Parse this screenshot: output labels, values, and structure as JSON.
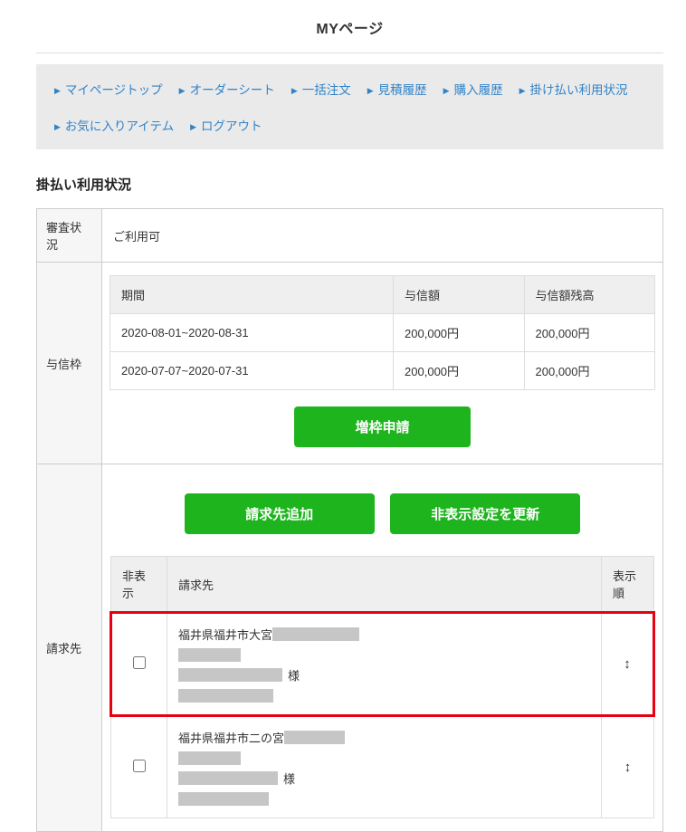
{
  "page": {
    "title": "MYページ"
  },
  "nav": {
    "arrow": "▶",
    "items": [
      {
        "label": "マイページトップ"
      },
      {
        "label": "オーダーシート"
      },
      {
        "label": "一括注文"
      },
      {
        "label": "見積履歴"
      },
      {
        "label": "購入履歴"
      },
      {
        "label": "掛け払い利用状況"
      },
      {
        "label": "お気に入りアイテム"
      },
      {
        "label": "ログアウト"
      }
    ]
  },
  "section": {
    "heading": "掛払い利用状況"
  },
  "status": {
    "label": "審査状況",
    "value": "ご利用可"
  },
  "credit": {
    "label": "与信枠",
    "columns": {
      "period": "期間",
      "amount": "与信額",
      "balance": "与信額残高"
    },
    "rows": [
      {
        "period": "2020-08-01~2020-08-31",
        "amount": "200,000円",
        "balance": "200,000円"
      },
      {
        "period": "2020-07-07~2020-07-31",
        "amount": "200,000円",
        "balance": "200,000円"
      }
    ],
    "increase_button": "増枠申請"
  },
  "billing": {
    "label": "請求先",
    "add_button": "請求先追加",
    "update_button": "非表示設定を更新",
    "columns": {
      "hide": "非表示",
      "address": "請求先",
      "order": "表示順"
    },
    "rows": [
      {
        "address_line1": "福井県福井市大宮",
        "honorific": "様",
        "order_icon": "↕",
        "highlighted": true
      },
      {
        "address_line1": "福井県福井市二の宮",
        "honorific": "様",
        "order_icon": "↕",
        "highlighted": false
      }
    ]
  },
  "colors": {
    "accent_green": "#1eb41e",
    "link_blue": "#3183c8",
    "highlight_red": "#e60012",
    "redaction_gray": "#c6c6c6"
  }
}
